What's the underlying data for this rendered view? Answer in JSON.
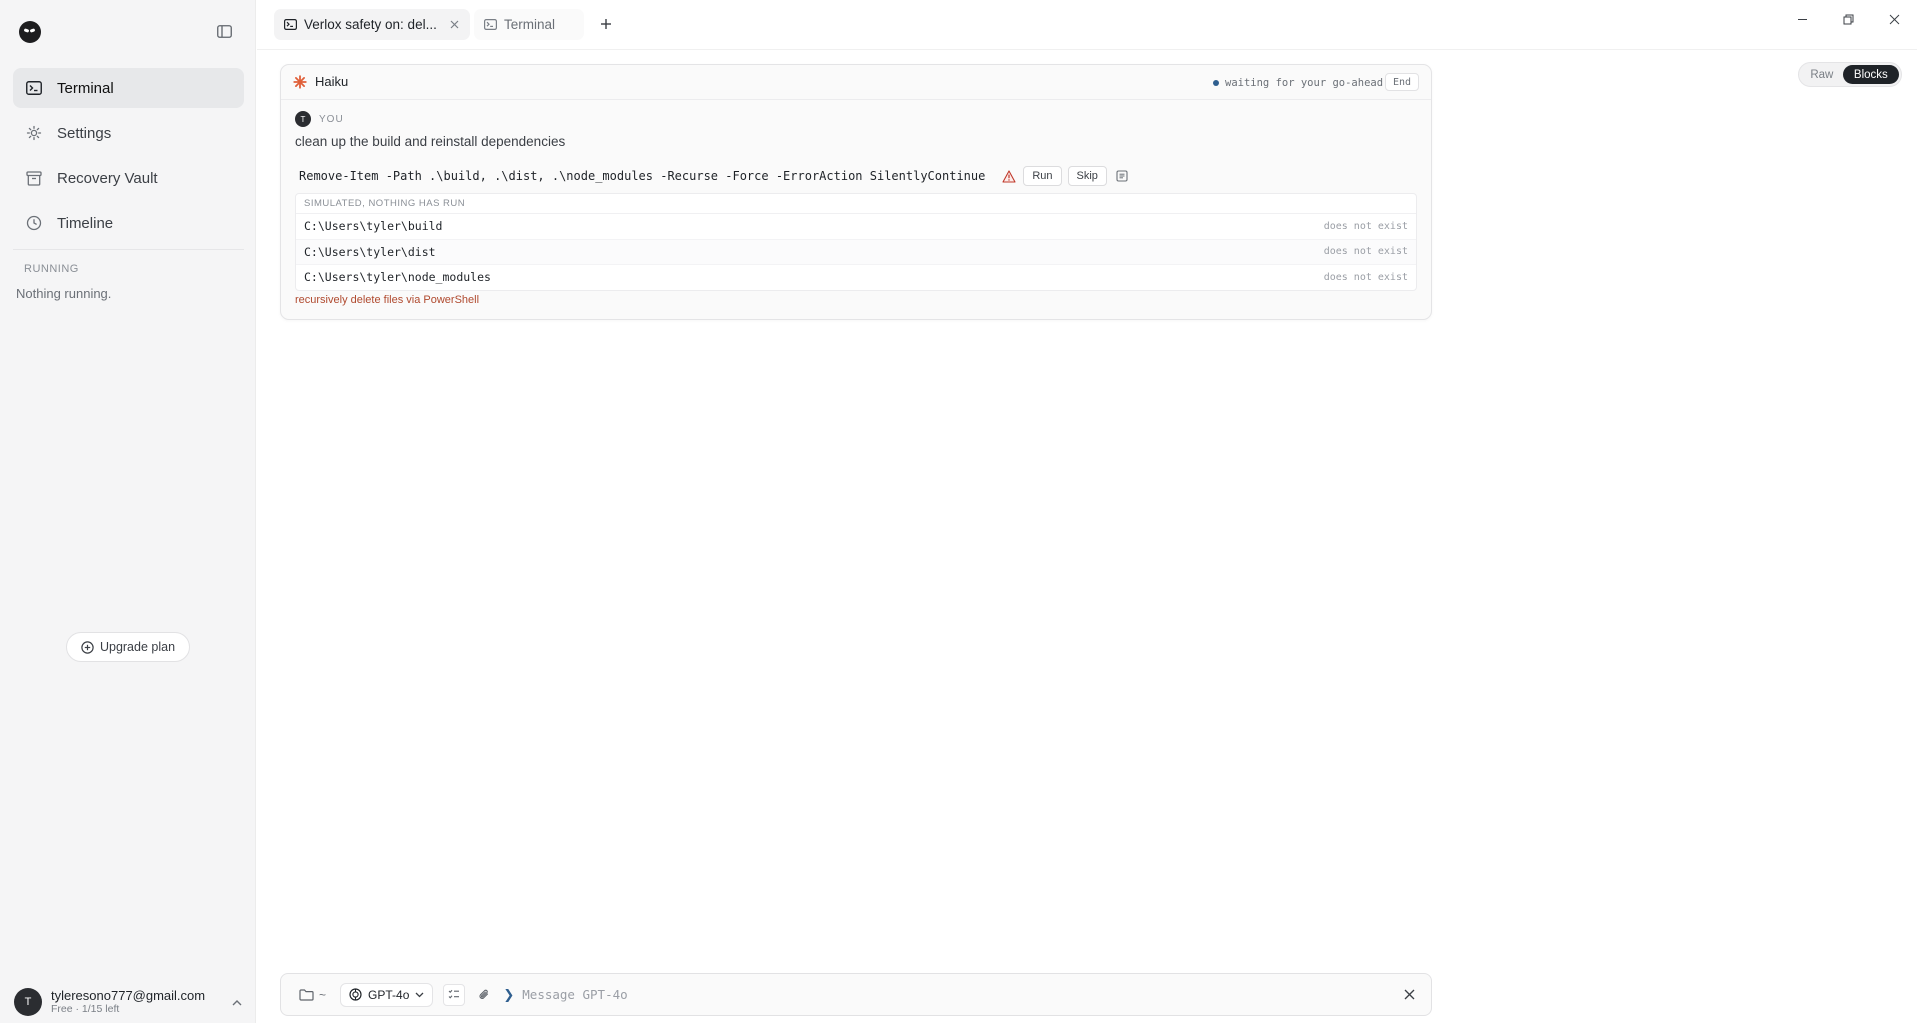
{
  "sidebar": {
    "items": [
      {
        "label": "Terminal",
        "icon": "terminal-icon"
      },
      {
        "label": "Settings",
        "icon": "gear-icon"
      },
      {
        "label": "Recovery Vault",
        "icon": "archive-icon"
      },
      {
        "label": "Timeline",
        "icon": "clock-icon"
      }
    ],
    "running_label": "RUNNING",
    "running_empty": "Nothing running.",
    "upgrade_label": "Upgrade plan",
    "user": {
      "initial": "T",
      "email": "tyleresono777@gmail.com",
      "plan": "Free · 1/15 left"
    }
  },
  "tabs": [
    {
      "title": "Verlox safety on: del...",
      "icon": "terminal-icon",
      "active": true
    },
    {
      "title": "Terminal",
      "icon": "terminal-icon",
      "active": false
    }
  ],
  "view_toggle": {
    "raw": "Raw",
    "blocks": "Blocks",
    "selected": "Blocks"
  },
  "card": {
    "agent": "Haiku",
    "status": "waiting for your go-ahead",
    "end_label": "End",
    "you_initial": "T",
    "you_label": "YOU",
    "prompt": "clean up the build and reinstall dependencies",
    "command": "Remove-Item -Path .\\build, .\\dist, .\\node_modules -Recurse -Force -ErrorAction SilentlyContinue",
    "run_label": "Run",
    "skip_label": "Skip",
    "simulation": {
      "header": "SIMULATED, NOTHING HAS RUN",
      "rows": [
        {
          "path": "C:\\Users\\tyler\\build",
          "state": "does not exist"
        },
        {
          "path": "C:\\Users\\tyler\\dist",
          "state": "does not exist"
        },
        {
          "path": "C:\\Users\\tyler\\node_modules",
          "state": "does not exist"
        }
      ]
    },
    "danger_note": "recursively delete files via PowerShell"
  },
  "composer": {
    "cwd": "~",
    "model": "GPT-4o",
    "placeholder": "Message GPT-4o"
  },
  "colors": {
    "accent": "#2f5f8f",
    "danger": "#b04a2f",
    "agent_icon": "#e0603a"
  }
}
